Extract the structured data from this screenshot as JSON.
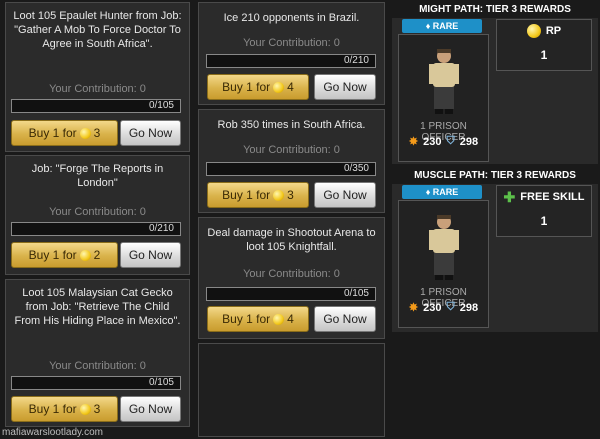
{
  "jobs": [
    {
      "title": "Loot 105 Epaulet Hunter from Job: \"Gather A Mob To Force Doctor To Agree in South Africa\".",
      "contribution": "Your Contribution: 0",
      "progress": "0/105",
      "buy_label": "Buy 1 for",
      "buy_cost": "3",
      "go_label": "Go Now"
    },
    {
      "title": "Job: \"Forge The Reports in London\"",
      "contribution": "Your Contribution: 0",
      "progress": "0/210",
      "buy_label": "Buy 1 for",
      "buy_cost": "2",
      "go_label": "Go Now"
    },
    {
      "title": "Loot 105 Malaysian Cat Gecko from Job: \"Retrieve The Child From His Hiding Place in Mexico\".",
      "contribution": "Your Contribution: 0",
      "progress": "0/105",
      "buy_label": "Buy 1 for",
      "buy_cost": "3",
      "go_label": "Go Now"
    },
    {
      "title": "Ice 210 opponents in Brazil.",
      "contribution": "Your Contribution: 0",
      "progress": "0/210",
      "buy_label": "Buy 1 for",
      "buy_cost": "4",
      "go_label": "Go Now"
    },
    {
      "title": "Rob 350 times in South Africa.",
      "contribution": "Your Contribution: 0",
      "progress": "0/350",
      "buy_label": "Buy 1 for",
      "buy_cost": "3",
      "go_label": "Go Now"
    },
    {
      "title": "Deal damage in Shootout Arena to loot 105 Knightfall.",
      "contribution": "Your Contribution: 0",
      "progress": "0/105",
      "buy_label": "Buy 1 for",
      "buy_cost": "4",
      "go_label": "Go Now"
    }
  ],
  "rewards": [
    {
      "header": "MIGHT PATH: TIER 3 REWARDS",
      "rarity": "RARE",
      "item_name": "1 PRISON OFFICER",
      "attack": "230",
      "defense": "298",
      "bonus_label": "RP",
      "bonus_value": "1",
      "bonus_icon": "rp-icon"
    },
    {
      "header": "MUSCLE PATH: TIER 3 REWARDS",
      "rarity": "RARE",
      "item_name": "1 PRISON OFFICER",
      "attack": "230",
      "defense": "298",
      "bonus_label": "FREE SKILL",
      "bonus_value": "1",
      "bonus_icon": "plus-icon"
    }
  ],
  "watermark": "mafiawarslootlady.com",
  "colors": {
    "gold_button": "#d9b24a",
    "rare_badge": "#1e90c8",
    "background": "#1a1a1a",
    "card": "#2b2b2b"
  }
}
